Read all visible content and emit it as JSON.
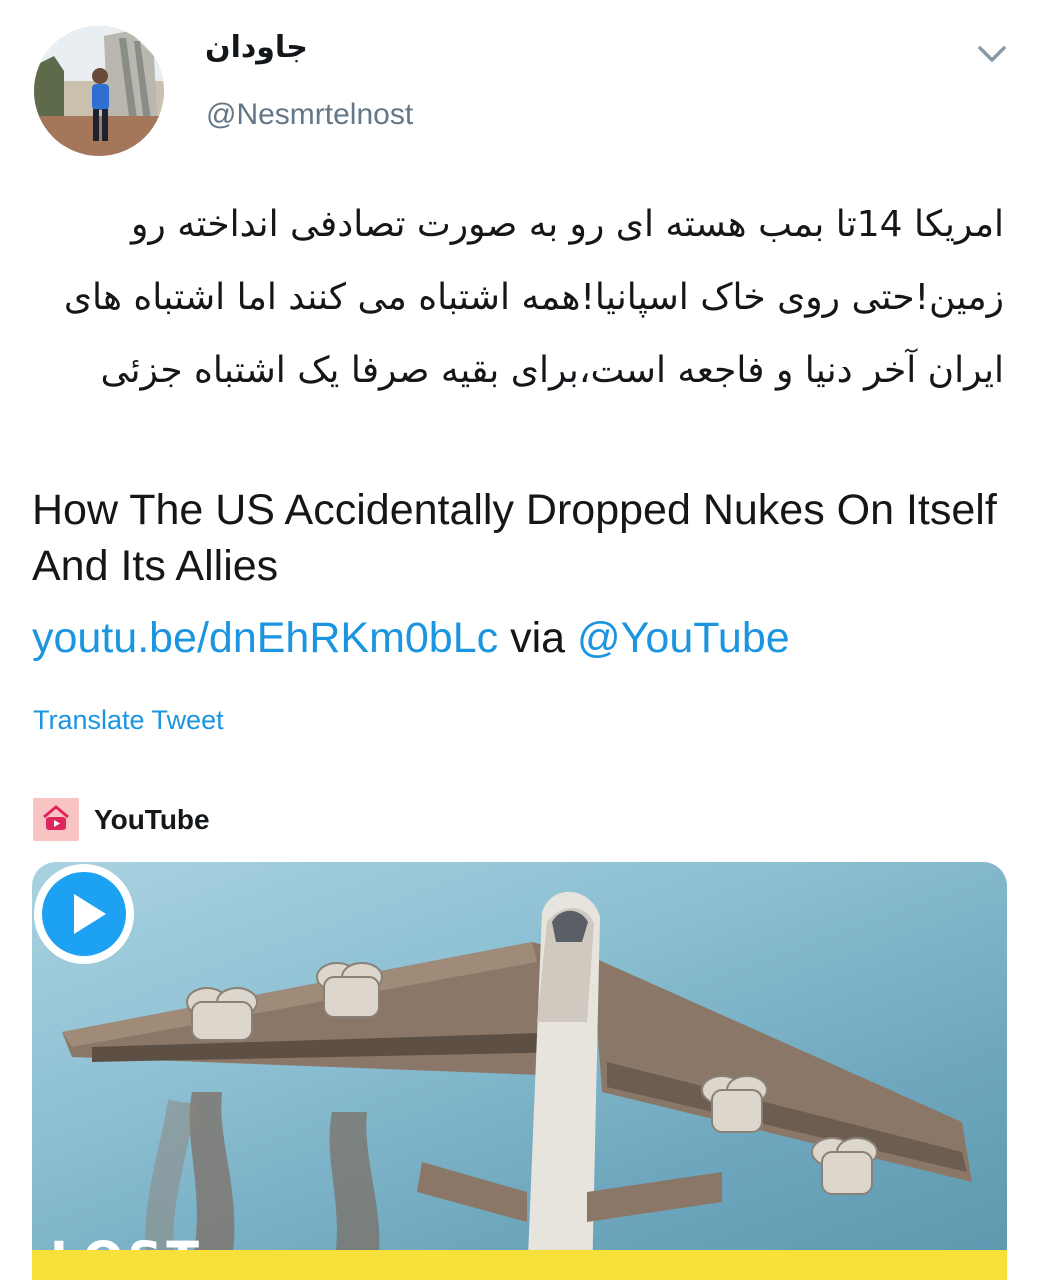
{
  "author": {
    "display_name": "جاودان",
    "handle": "@Nesmrtelnost"
  },
  "tweet": {
    "text_fa": "امریکا 14تا بمب هسته ای رو به صورت تصادفی انداخته رو زمین!حتی روی خاک اسپانیا!همه اشتباه می کنند اما اشتباه های ایران آخر دنیا و فاجعه است،برای بقیه صرفا یک اشتباه جزئی",
    "text_en": "How The US Accidentally Dropped Nukes On Itself And Its Allies",
    "link": "youtu.be/dnEhRKm0bLc",
    "via": "via",
    "mention": "@YouTube",
    "translate_label": "Translate Tweet"
  },
  "card": {
    "source": "YouTube",
    "thumbnail_text": "LOST"
  },
  "icons": {
    "menu": "chevron-down-icon",
    "source": "youtube-icon",
    "play": "play-icon"
  },
  "colors": {
    "link": "#1b95e0",
    "secondary_text": "#657786",
    "play_button": "#1da1f2",
    "banner": "#f7e03a"
  }
}
